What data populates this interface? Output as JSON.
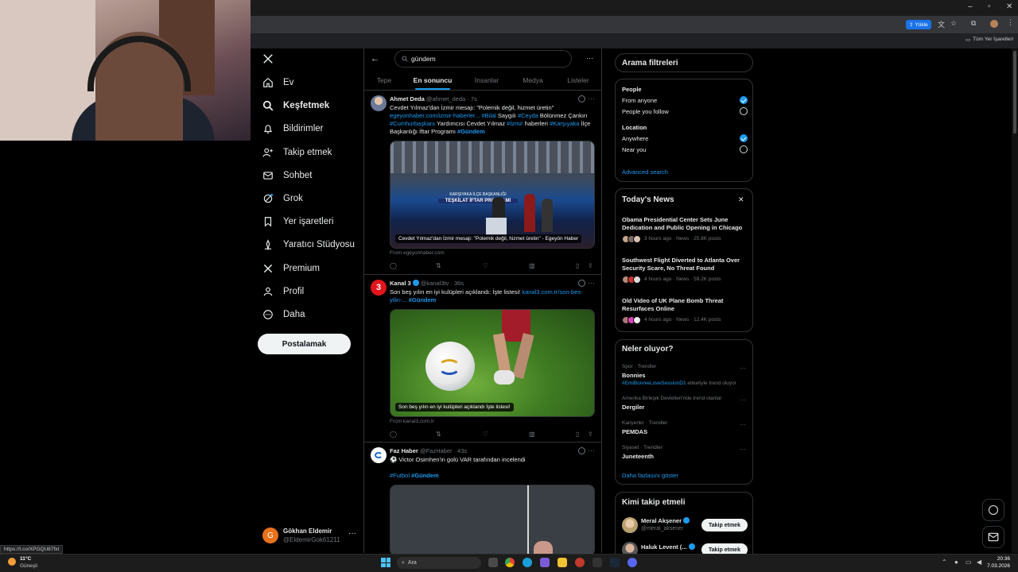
{
  "browser": {
    "upload_label": "Yükle",
    "bookmarks_all": "Tüm Yer İşaretleri"
  },
  "nav": {
    "items": [
      {
        "label": "Ev",
        "icon": "home-icon"
      },
      {
        "label": "Keşfetmek",
        "icon": "search-icon",
        "active": true
      },
      {
        "label": "Bildirimler",
        "icon": "bell-icon"
      },
      {
        "label": "Takip etmek",
        "icon": "person-add-icon"
      },
      {
        "label": "Sohbet",
        "icon": "mail-icon"
      },
      {
        "label": "Grok",
        "icon": "grok-icon"
      },
      {
        "label": "Yer işaretleri",
        "icon": "bookmark-icon"
      },
      {
        "label": "Yaratıcı Stüdyosu",
        "icon": "creator-icon"
      },
      {
        "label": "Premium",
        "icon": "x-icon"
      },
      {
        "label": "Profil",
        "icon": "profile-icon"
      },
      {
        "label": "Daha",
        "icon": "more-circle-icon"
      }
    ],
    "post_label": "Postalamak",
    "account": {
      "initial": "G",
      "name": "Gökhan Eldemir",
      "handle": "@EldemirGok61211"
    }
  },
  "search": {
    "query": "gündem"
  },
  "tabs": [
    "Tepe",
    "En sonuncu",
    "İnsanlar",
    "Medya",
    "Listeler"
  ],
  "tweets": [
    {
      "name": "Ahmet Deda",
      "meta": "@ahmet_deda · 7s",
      "lines": [
        [
          {
            "t": "Cevdet Yılmaz'dan İzmir mesajı: \"Polemik değil, hizmet üretin\""
          }
        ],
        [
          {
            "t": "egeyonhaber.com/izmir-haberler...",
            "l": 1
          },
          {
            "t": " "
          },
          {
            "t": "#Bilal",
            "l": 1
          },
          {
            "t": " Saygılı "
          },
          {
            "t": "#Ceyda",
            "l": 1
          },
          {
            "t": " Bölünmez Çankırı"
          }
        ],
        [
          {
            "t": "#Cumhurbaşkanı",
            "l": 1
          },
          {
            "t": " Yardımcısı Cevdet Yılmaz "
          },
          {
            "t": "#İzmir",
            "l": 1
          },
          {
            "t": " haberleri "
          },
          {
            "t": "#Karşıyaka",
            "l": 1
          },
          {
            "t": " İlçe"
          }
        ],
        [
          {
            "t": "Başkanlığı İftar Programı "
          },
          {
            "t": "#Gündem",
            "l": 1,
            "b": 1
          }
        ]
      ],
      "caption": "Cevdet Yılmaz'dan İzmir mesajı: \"Polemik değil, hizmet üretin\" - Egeyön Haber",
      "banner": "TEŞKİLAT İFTAR PROGRAMI",
      "banner_top": "KARŞIYAKA İLÇE BAŞKANLIĞI",
      "from": "From egeyonhaber.com"
    },
    {
      "name": "Kanal 3",
      "meta": "@kanal3tv · 36s",
      "lines": [
        [
          {
            "t": "Son beş yılın en iyi kulüpleri açıklandı: İşte listesi! "
          },
          {
            "t": "kanal3.com.tr/son-bes-",
            "l": 1
          }
        ],
        [
          {
            "t": "yilin-...",
            "l": 1
          },
          {
            "t": " "
          },
          {
            "t": "#Gündem",
            "l": 1,
            "b": 1
          }
        ]
      ],
      "caption": "Son beş yılın en iyi kulüpleri açıklandı İşte listesi!",
      "from": "From kanal3.com.tr"
    },
    {
      "name": "Faz Haber",
      "meta": "@FazHaber · 43s",
      "lines": [
        [
          {
            "t": "⚽ Victor Osimhen'in golü VAR tarafından incelendi"
          }
        ]
      ],
      "tags": [
        {
          "t": "#Futbol",
          "l": 1
        },
        {
          "t": " "
        },
        {
          "t": "#Gündem",
          "l": 1,
          "b": 1
        }
      ]
    }
  ],
  "filters": {
    "title": "Arama filtreleri",
    "people_label": "People",
    "people_options": [
      "From anyone",
      "People you follow"
    ],
    "location_label": "Location",
    "location_options": [
      "Anywhere",
      "Near you"
    ],
    "advanced": "Advanced search"
  },
  "news": {
    "title": "Today's News",
    "items": [
      {
        "title": "Obama Presidential Center Sets June Dedication and Public Opening in Chicago",
        "meta": "3 hours ago · News · 25.8K posts"
      },
      {
        "title": "Southwest Flight Diverted to Atlanta Over Security Scare, No Threat Found",
        "meta": "4 hours ago · News · 59.2K posts"
      },
      {
        "title": "Old Video of UK Plane Bomb Threat Resurfaces Online",
        "meta": "4 hours ago · News · 12.4K posts"
      }
    ]
  },
  "trends": {
    "title": "Neler oluyor?",
    "items": [
      {
        "cat": "Spor · Trendler",
        "name": "Bonnies",
        "sub": "#EmiBonnieLoveSessionD1 etiketiyle trend oluyor"
      },
      {
        "cat": "Amerika Birleşik Devletleri'nde trend olanlar",
        "name": "Dergiler",
        "sub": ""
      },
      {
        "cat": "Kariyerler · Trendler",
        "name": "PEMDAS",
        "sub": ""
      },
      {
        "cat": "Siyaset · Trendler",
        "name": "Juneteenth",
        "sub": ""
      }
    ],
    "more": "Daha fazlasını göster"
  },
  "who_to_follow": {
    "title": "Kimi takip etmeli",
    "items": [
      {
        "name": "Meral Akşener",
        "handle": "@meral_aksener",
        "button": "Takip etmek"
      },
      {
        "name": "Haluk Levent (...",
        "handle": "",
        "button": "Takip etmek"
      }
    ]
  },
  "status_url": "https://t.co/XPGQU87fxt",
  "taskbar": {
    "weather_temp": "11°C",
    "weather_text": "Güneşli",
    "search_placeholder": "Ara",
    "time": "20:36",
    "date": "7.03.2026"
  }
}
